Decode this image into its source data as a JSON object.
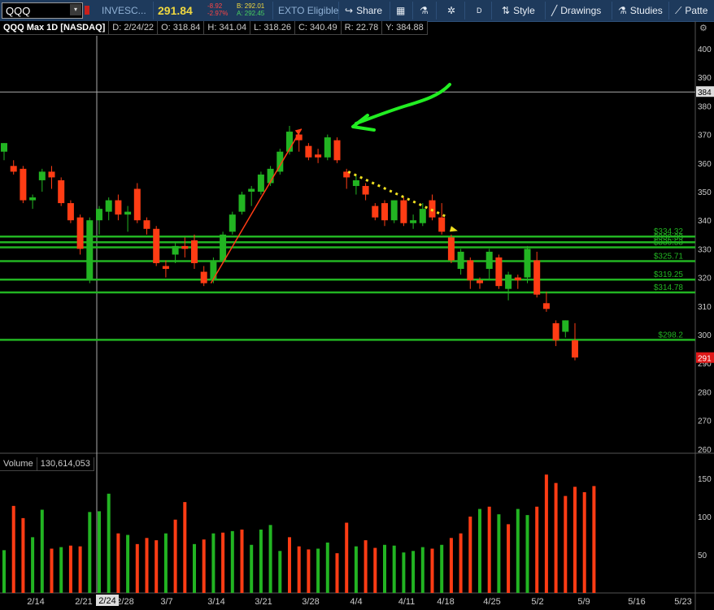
{
  "toolbar": {
    "symbol": "QQQ",
    "company": "INVESC...",
    "last_price": "291.84",
    "change": "-8.92",
    "change_pct": "-2.97%",
    "bid": "B: 292.01",
    "ask": "A: 292.45",
    "exto": "EXTO Eligible",
    "share_label": "Share",
    "period_label": "D",
    "style_label": "Style",
    "drawings_label": "Drawings",
    "studies_label": "Studies",
    "patterns_label": "Patte"
  },
  "header": {
    "title": "QQQ Max 1D [NASDAQ]",
    "date": "D: 2/24/22",
    "open": "O: 318.84",
    "high": "H: 341.04",
    "low": "L: 318.26",
    "close": "C: 340.49",
    "range": "R: 22.78",
    "y": "Y: 384.88"
  },
  "volume_header": {
    "label": "Volume",
    "value": "130,614,053"
  },
  "colors": {
    "up": "#22b422",
    "down": "#ff3c14",
    "support": "#22b422",
    "price_badge": "#e01818",
    "arrow_green": "#22ee22",
    "trend_line": "#ff3c14",
    "dotted": "#f0e020"
  },
  "chart_data": [
    {
      "type": "candlestick",
      "title": "QQQ Max 1D [NASDAQ]",
      "x": [
        "2/14",
        "2/21",
        "2/24",
        "2/28",
        "3/7",
        "3/14",
        "3/21",
        "3/28",
        "4/4",
        "4/11",
        "4/18",
        "4/25",
        "5/2",
        "5/9",
        "5/16",
        "5/23"
      ],
      "x_tick_labels": [
        "2/14",
        "2/21",
        "2/28",
        "3/7",
        "3/14",
        "3/21",
        "3/28",
        "4/4",
        "4/11",
        "4/18",
        "4/25",
        "5/2",
        "5/9",
        "5/16",
        "5/23"
      ],
      "crosshair_label": "2/24",
      "crosshair_price": "384",
      "last_price_label": "291",
      "yticks": [
        260,
        270,
        280,
        290,
        300,
        310,
        320,
        330,
        340,
        350,
        360,
        370,
        380,
        390,
        400
      ],
      "ylim": [
        258,
        405
      ],
      "candles": [
        {
          "o": 364,
          "h": 367,
          "l": 361,
          "c": 367
        },
        {
          "o": 359,
          "h": 361,
          "l": 356,
          "c": 357
        },
        {
          "o": 358,
          "h": 359,
          "l": 346,
          "c": 347
        },
        {
          "o": 347,
          "h": 349,
          "l": 344,
          "c": 348
        },
        {
          "o": 354,
          "h": 358,
          "l": 350,
          "c": 357
        },
        {
          "o": 357,
          "h": 359,
          "l": 351,
          "c": 355
        },
        {
          "o": 354,
          "h": 355,
          "l": 345,
          "c": 346
        },
        {
          "o": 346,
          "h": 347,
          "l": 339,
          "c": 340
        },
        {
          "o": 341,
          "h": 342,
          "l": 328,
          "c": 330
        },
        {
          "o": 319,
          "h": 341,
          "l": 318,
          "c": 340
        },
        {
          "o": 340,
          "h": 345,
          "l": 335,
          "c": 344
        },
        {
          "o": 343,
          "h": 348,
          "l": 340,
          "c": 347
        },
        {
          "o": 347,
          "h": 349,
          "l": 340,
          "c": 342
        },
        {
          "o": 342,
          "h": 345,
          "l": 336,
          "c": 343
        },
        {
          "o": 351,
          "h": 353,
          "l": 339,
          "c": 340
        },
        {
          "o": 340,
          "h": 341,
          "l": 335,
          "c": 337
        },
        {
          "o": 337,
          "h": 338,
          "l": 324,
          "c": 325
        },
        {
          "o": 324,
          "h": 326,
          "l": 320,
          "c": 323
        },
        {
          "o": 328,
          "h": 332,
          "l": 325,
          "c": 331
        },
        {
          "o": 331,
          "h": 334,
          "l": 327,
          "c": 330
        },
        {
          "o": 333,
          "h": 335,
          "l": 323,
          "c": 325
        },
        {
          "o": 322,
          "h": 324,
          "l": 317,
          "c": 318
        },
        {
          "o": 319,
          "h": 327,
          "l": 318,
          "c": 326
        },
        {
          "o": 326,
          "h": 336,
          "l": 325,
          "c": 335
        },
        {
          "o": 336,
          "h": 343,
          "l": 335,
          "c": 342
        },
        {
          "o": 343,
          "h": 350,
          "l": 342,
          "c": 349
        },
        {
          "o": 350,
          "h": 352,
          "l": 345,
          "c": 351
        },
        {
          "o": 350,
          "h": 357,
          "l": 349,
          "c": 356
        },
        {
          "o": 353,
          "h": 359,
          "l": 352,
          "c": 358
        },
        {
          "o": 357,
          "h": 365,
          "l": 356,
          "c": 364
        },
        {
          "o": 364,
          "h": 373,
          "l": 363,
          "c": 371
        },
        {
          "o": 370,
          "h": 371,
          "l": 364,
          "c": 368
        },
        {
          "o": 366,
          "h": 367,
          "l": 361,
          "c": 362
        },
        {
          "o": 363,
          "h": 365,
          "l": 360,
          "c": 362
        },
        {
          "o": 362,
          "h": 370,
          "l": 361,
          "c": 369
        },
        {
          "o": 368,
          "h": 369,
          "l": 360,
          "c": 361
        },
        {
          "o": 357,
          "h": 358,
          "l": 351,
          "c": 355
        },
        {
          "o": 352,
          "h": 356,
          "l": 349,
          "c": 354
        },
        {
          "o": 352,
          "h": 353,
          "l": 347,
          "c": 349
        },
        {
          "o": 345,
          "h": 346,
          "l": 340,
          "c": 341
        },
        {
          "o": 346,
          "h": 347,
          "l": 338,
          "c": 340
        },
        {
          "o": 340,
          "h": 347,
          "l": 339,
          "c": 347
        },
        {
          "o": 347,
          "h": 348,
          "l": 338,
          "c": 339
        },
        {
          "o": 339,
          "h": 342,
          "l": 337,
          "c": 340
        },
        {
          "o": 339,
          "h": 346,
          "l": 338,
          "c": 344
        },
        {
          "o": 347,
          "h": 349,
          "l": 340,
          "c": 341
        },
        {
          "o": 341,
          "h": 346,
          "l": 335,
          "c": 336
        },
        {
          "o": 334,
          "h": 335,
          "l": 325,
          "c": 326
        },
        {
          "o": 323,
          "h": 330,
          "l": 321,
          "c": 329
        },
        {
          "o": 326,
          "h": 327,
          "l": 316,
          "c": 319
        },
        {
          "o": 319,
          "h": 320,
          "l": 316,
          "c": 318
        },
        {
          "o": 323,
          "h": 330,
          "l": 319,
          "c": 329
        },
        {
          "o": 327,
          "h": 328,
          "l": 316,
          "c": 317
        },
        {
          "o": 316,
          "h": 322,
          "l": 312,
          "c": 321
        },
        {
          "o": 320,
          "h": 321,
          "l": 316,
          "c": 319
        },
        {
          "o": 320,
          "h": 331,
          "l": 318,
          "c": 330
        },
        {
          "o": 326,
          "h": 329,
          "l": 313,
          "c": 314
        },
        {
          "o": 311,
          "h": 315,
          "l": 308,
          "c": 309
        },
        {
          "o": 304,
          "h": 305,
          "l": 296,
          "c": 298
        },
        {
          "o": 301,
          "h": 305,
          "l": 299,
          "c": 305
        },
        {
          "o": 298,
          "h": 304,
          "l": 291,
          "c": 292
        }
      ],
      "support_levels": [
        {
          "value": 334.32,
          "label": "$334.32"
        },
        {
          "value": 332.33,
          "label": "$332.33"
        },
        {
          "value": 330.53,
          "label": "$330.53"
        },
        {
          "value": 325.71,
          "label": "$325.71"
        },
        {
          "value": 319.25,
          "label": "$319.25"
        },
        {
          "value": 314.78,
          "label": "$314.78"
        },
        {
          "value": 298.2,
          "label": "$298.2"
        }
      ],
      "annotations": [
        "red trend line from 3/14 low to 4/1 high",
        "green hand-drawn arrow pointing to 4/4 peak",
        "yellow dotted line from 4/5 to 4/21",
        "yellow marker triangle at 4/21"
      ]
    },
    {
      "type": "bar",
      "title": "Volume",
      "yticks": [
        50,
        100,
        150
      ],
      "ylim": [
        0,
        165
      ],
      "values": [
        56,
        114,
        98,
        73,
        109,
        58,
        60,
        62,
        61,
        106,
        107,
        130,
        78,
        76,
        64,
        72,
        69,
        78,
        96,
        119,
        64,
        70,
        78,
        79,
        81,
        83,
        63,
        83,
        89,
        55,
        73,
        61,
        57,
        58,
        66,
        52,
        92,
        61,
        69,
        59,
        63,
        62,
        53,
        55,
        60,
        58,
        63,
        72,
        78,
        100,
        110,
        113,
        103,
        90,
        110,
        102,
        113,
        155,
        144,
        127,
        139,
        132,
        140
      ],
      "volume_up_flags": [
        1,
        0,
        0,
        1,
        1,
        0,
        1,
        0,
        0,
        1,
        1,
        1,
        0,
        1,
        0,
        0,
        0,
        1,
        0,
        0,
        1,
        0,
        1,
        0,
        1,
        0,
        1,
        1,
        1,
        1,
        0,
        0,
        0,
        1,
        1,
        0,
        0,
        1,
        0,
        0,
        1,
        1,
        1,
        1,
        1,
        0,
        1,
        0,
        0,
        0,
        1,
        0,
        1,
        0,
        1,
        1,
        0,
        0,
        0,
        0,
        0,
        0,
        0
      ]
    }
  ]
}
